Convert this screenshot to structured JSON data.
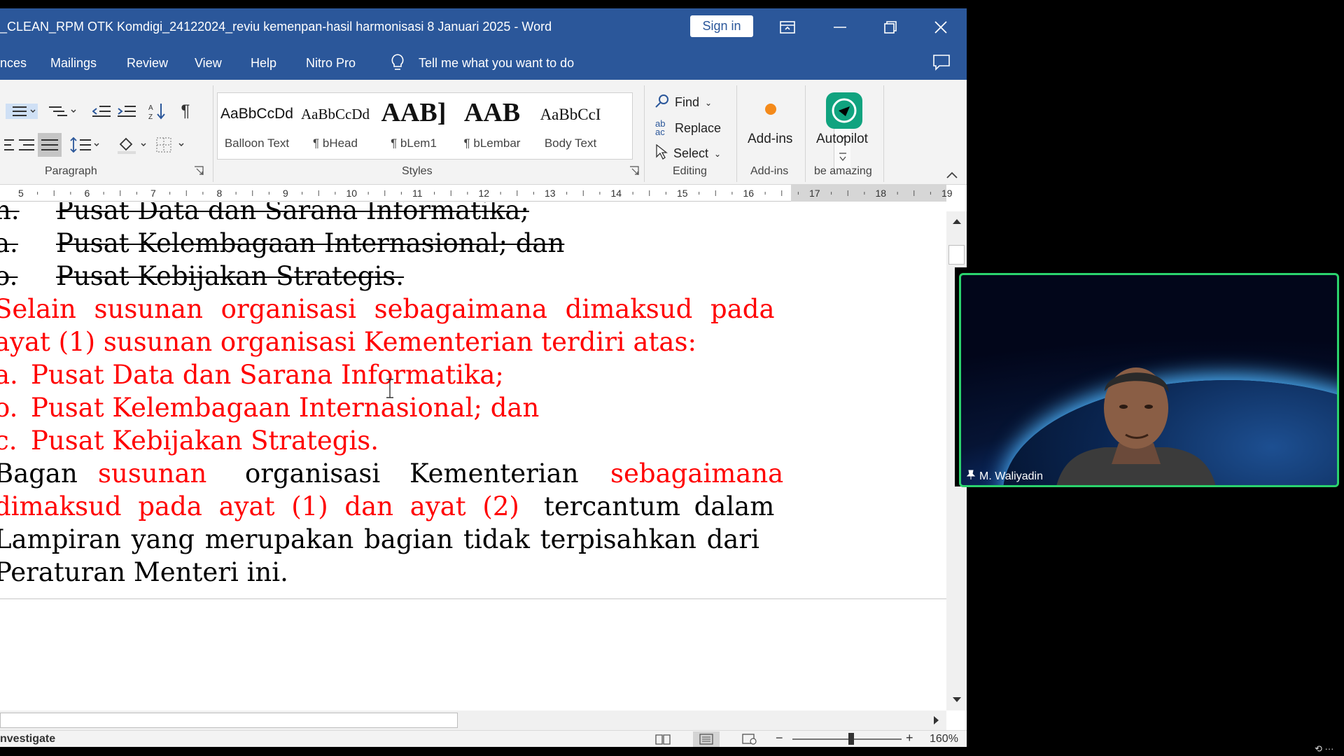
{
  "window": {
    "title": "_CLEAN_RPM OTK Komdigi_24122024_reviu kemenpan-hasil harmonisasi 8 Januari 2025  -  Word",
    "sign_in": "Sign in"
  },
  "tabs": [
    "nces",
    "Mailings",
    "Review",
    "View",
    "Help",
    "Nitro Pro"
  ],
  "tell_me": "Tell me what you want to do",
  "ribbon": {
    "paragraph_label": "Paragraph",
    "styles_label": "Styles",
    "editing_label": "Editing",
    "addins_group_label": "Add-ins",
    "amazing_label": "be amazing",
    "styles": [
      {
        "sample": "AaBbCcDd",
        "name": "Balloon Text"
      },
      {
        "sample": "AaBbCcDd",
        "name": "¶ bHead"
      },
      {
        "sample": "AAB]",
        "name": "¶ bLem1"
      },
      {
        "sample": "AAB",
        "name": "¶ bLembar"
      },
      {
        "sample": "AaBbCcI",
        "name": "Body Text"
      }
    ],
    "find": "Find",
    "replace": "Replace",
    "select": "Select",
    "addins_button": "Add-ins",
    "autopilot_button": "Autopilot"
  },
  "ruler": [
    "5",
    "6",
    "7",
    "8",
    "9",
    "10",
    "11",
    "12",
    "13",
    "14",
    "15",
    "16",
    "17",
    "18",
    "19"
  ],
  "document": {
    "l1_marker": "n.",
    "l1_text": "Pusat Data dan Sarana Informatika;",
    "l2_marker": "a.",
    "l2_text": "Pusat Kelembagaan Internasional; dan",
    "l3_marker": "o.",
    "l3_text": "Pusat Kebijakan Strategis.",
    "l4": "Selain susunan organisasi sebagaimana dimaksud pada",
    "l5": "ayat (1) susunan organisasi Kementerian terdiri atas:",
    "l6_marker": "a.",
    "l6_text": "Pusat Data dan Sarana Informatika;",
    "l7_marker": "o.",
    "l7_text": "Pusat Kelembagaan Internasional; dan",
    "l8_marker": "c.",
    "l8_text": "Pusat Kebijakan Strategis.",
    "l9_a": "Bagan",
    "l9_b": "susunan",
    "l9_c": "organisasi",
    "l9_d": "Kementerian",
    "l9_e": "sebagaimana",
    "l10_a": "dimaksud pada ayat (1) dan ayat (2)",
    "l10_b": "tercantum dalam",
    "l11": "Lampiran yang merupakan bagian tidak terpisahkan dari",
    "l12": "Peraturan Menteri ini."
  },
  "status": {
    "left": "nvestigate",
    "zoom": "160%"
  },
  "video": {
    "participant": "M. Waliyadin"
  },
  "colors": {
    "word_blue": "#2b579a",
    "tracked_red": "#ff0000",
    "speaker_border": "#2bd26d"
  }
}
